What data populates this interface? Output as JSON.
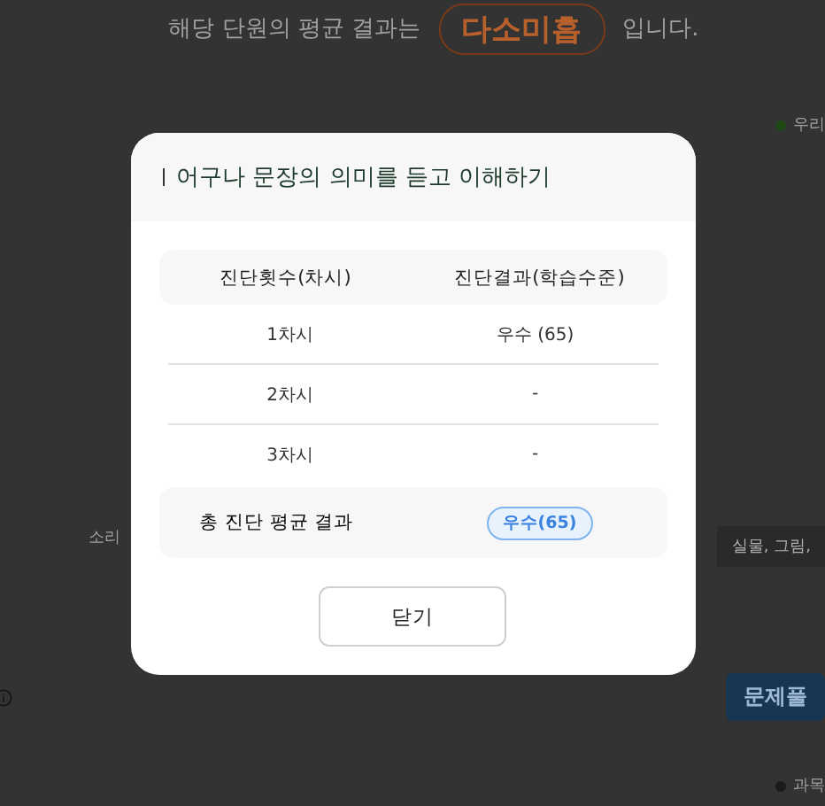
{
  "page": {
    "summary_before": "해당 단원의 평균 결과는",
    "summary_badge": "다소미흡",
    "summary_after": "입니다.",
    "legend_top": "우리",
    "column_left": "소리",
    "column_right": "실물, 그림,",
    "solve_button": "문제풀",
    "legend_bottom": "과목"
  },
  "dialog": {
    "title": "어구나 문장의 의미를 듣고 이해하기",
    "columns": [
      "진단횟수(차시)",
      "진단결과(학습수준)"
    ],
    "rows": [
      {
        "session": "1차시",
        "result": "우수 (65)"
      },
      {
        "session": "2차시",
        "result": "-"
      },
      {
        "session": "3차시",
        "result": "-"
      }
    ],
    "total": {
      "label": "총 진단 평균 결과",
      "badge": "우수(65)"
    },
    "close_button": "닫기"
  }
}
